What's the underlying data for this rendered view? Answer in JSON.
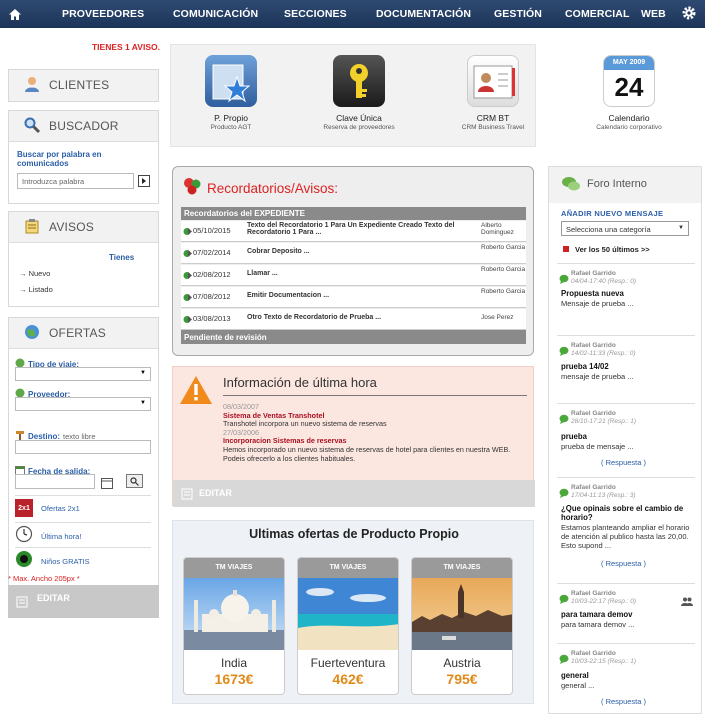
{
  "nav": {
    "items": [
      "PROVEEDORES",
      "COMUNICACIÓN",
      "SECCIONES",
      "DOCUMENTACIÓN",
      "GESTIÓN",
      "COMERCIAL",
      "WEB"
    ]
  },
  "left": {
    "alert": "TIENES 1 AVISO.",
    "clientes": {
      "title": "CLIENTES"
    },
    "buscador": {
      "title": "BUSCADOR",
      "label": "Buscar por palabra en comunicados",
      "placeholder": "Introduzca palabra"
    },
    "avisos": {
      "title": "AVISOS",
      "tienes": "Tienes",
      "items": [
        "Nuevo",
        "Listado"
      ]
    },
    "ofertas": {
      "title": "OFERTAS",
      "tipo_label": "Tipo de viaje:",
      "proveedor_label": "Proveedor:",
      "destino_label": "Destino:",
      "destino_hint": "texto libre",
      "fecha_label": "Fecha de salida:",
      "links": [
        {
          "icon": "2x1",
          "label": "Ofertas 2x1"
        },
        {
          "icon": "clock",
          "label": "Última hora!"
        },
        {
          "icon": "kids",
          "label": "Niños GRATIS"
        }
      ]
    },
    "max_note": "* Max. Ancho 205px *",
    "editar": "EDITAR"
  },
  "apps": [
    {
      "title": "P. Propio",
      "subtitle": "Producto AGT"
    },
    {
      "title": "Clave Única",
      "subtitle": "Reserva de proveedores"
    },
    {
      "title": "CRM BT",
      "subtitle": "CRM Business Travel"
    },
    {
      "title": "Calendario",
      "subtitle": "Calendario corporativo",
      "month": "MAY 2009",
      "day": "24"
    }
  ],
  "recordatorios": {
    "title": "Recordatorios/Avisos:",
    "header": "Recordatorios del EXPEDIENTE",
    "rows": [
      {
        "date": "05/10/2015",
        "text": "Texto del Recordatorio 1 Para Un Expediente Creado Texto del Recordatorio 1 Para ...",
        "author": "Alberto Dominguez"
      },
      {
        "date": "07/02/2014",
        "text": "Cobrar Deposito ...",
        "author": "Roberto Garcia"
      },
      {
        "date": "02/08/2012",
        "text": "Llamar ...",
        "author": "Roberto Garcia"
      },
      {
        "date": "07/08/2012",
        "text": "Emitir Documentacion ...",
        "author": "Roberto Garcia"
      },
      {
        "date": "03/08/2013",
        "text": "Otro Texto de Recordatorio de Prueba ...",
        "author": "Jose Perez"
      }
    ],
    "footer": "Pendiente de revisión"
  },
  "info": {
    "title": "Información de última hora",
    "entries": [
      {
        "date": "08/03/2007",
        "head": "Sistema de Ventas Transhotel",
        "body": "Transhotel incorpora un nuevo sistema de reservas"
      },
      {
        "date": "27/03/2006",
        "head": "Incorporacion Sistemas de reservas",
        "body": "Hemos incorporado un nuevo sistema de reservas de hotel para clientes en nuestra WEB. Podeis ofrecerlo a los clientes habituales."
      }
    ],
    "editar": "EDITAR"
  },
  "offers": {
    "title": "Ultimas ofertas de Producto Propio",
    "cards": [
      {
        "band": "TM VIAJES",
        "place": "India",
        "price": "1673€"
      },
      {
        "band": "TM VIAJES",
        "place": "Fuerteventura",
        "price": "462€"
      },
      {
        "band": "TM VIAJES",
        "place": "Austria",
        "price": "795€"
      }
    ]
  },
  "foro": {
    "title": "Foro Interno",
    "add_label": "AÑADIR NUEVO MENSAJE",
    "select_value": "Selecciona una categoría",
    "last_link": "Ver los 50 últimos >>",
    "posts": [
      {
        "author": "Rafael Garrido",
        "time": "04/04-17:40 (Resp.: 0)",
        "title": "Propuesta nueva",
        "body": "Mensaje de prueba ...",
        "reply": ""
      },
      {
        "author": "Rafael Garrido",
        "time": "14/02-11:33 (Resp.: 0)",
        "title": "prueba 14/02",
        "body": "mensaje de prueba ...",
        "reply": ""
      },
      {
        "author": "Rafael Garrido",
        "time": "28/10-17:21 (Resp.: 1)",
        "title": "prueba",
        "body": "prueba de mensaje ...",
        "reply": "( Respuesta )"
      },
      {
        "author": "Rafael Garrido",
        "time": "17/04-11:13 (Resp.: 3)",
        "title": "¿Que opinais sobre el cambio de horario?",
        "body": "Estamos planteando ampliar el horario de atención al publico hasta las 20,00. Esto supond ...",
        "reply": "( Respuesta )"
      },
      {
        "author": "Rafael Garrido",
        "time": "10/03-22:17 (Resp.: 0)",
        "title": "para tamara demov",
        "body": "para tamara demov ...",
        "reply": ""
      },
      {
        "author": "Rafael Garrido",
        "time": "10/03-22:15 (Resp.: 1)",
        "title": "general",
        "body": "general ...",
        "reply": "( Respuesta )"
      }
    ]
  }
}
